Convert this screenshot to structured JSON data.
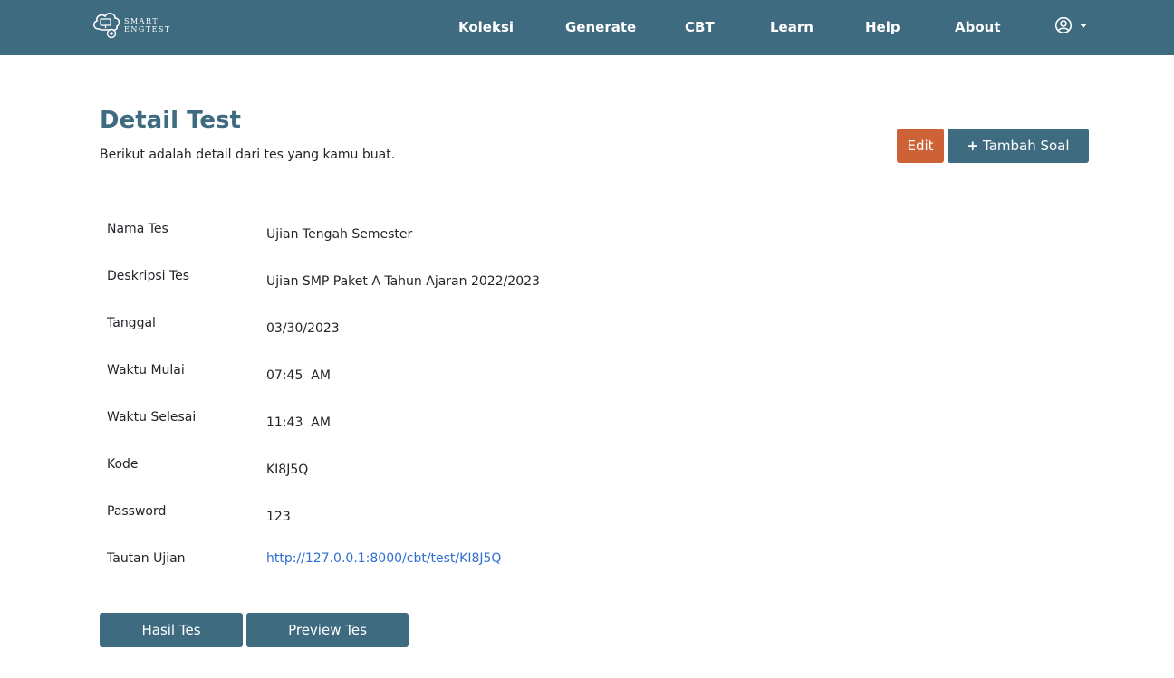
{
  "brand": {
    "line1": "SMART",
    "line2": "ENGTEST",
    "logo_icon": "cloud-monitor-logo-icon"
  },
  "nav": {
    "items": [
      {
        "label": "Koleksi"
      },
      {
        "label": "Generate"
      },
      {
        "label": "CBT"
      },
      {
        "label": "Learn"
      },
      {
        "label": "Help"
      },
      {
        "label": "About"
      }
    ],
    "user_icon": "user-circle-icon",
    "dropdown_icon": "caret-down-icon"
  },
  "header": {
    "title": "Detail Test",
    "subtitle": "Berikut adalah detail dari tes yang kamu buat."
  },
  "actions": {
    "edit_label": "Edit",
    "add_plus": "+",
    "add_label": "Tambah Soal"
  },
  "details": [
    {
      "label": "Nama Tes",
      "value": "Ujian Tengah Semester"
    },
    {
      "label": "Deskripsi Tes",
      "value": "Ujian SMP Paket A Tahun Ajaran 2022/2023"
    },
    {
      "label": "Tanggal",
      "value": "03/30/2023"
    },
    {
      "label": "Waktu Mulai",
      "value": "07:45  AM"
    },
    {
      "label": "Waktu Selesai",
      "value": "11:43  AM"
    },
    {
      "label": "Kode",
      "value": "KI8J5Q"
    },
    {
      "label": "Password",
      "value": "123"
    },
    {
      "label": "Tautan Ujian",
      "value": "http://127.0.0.1:8000/cbt/test/KI8J5Q"
    }
  ],
  "footer_buttons": {
    "hasil_label": "Hasil Tes",
    "preview_label": "Preview Tes"
  },
  "colors": {
    "primary": "#3f6b80",
    "edit": "#cd6236",
    "link": "#2f6fd1"
  }
}
